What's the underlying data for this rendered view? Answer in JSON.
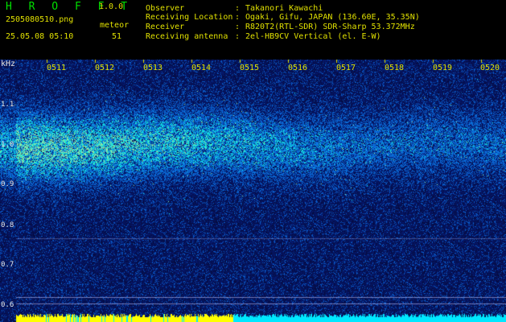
{
  "app": {
    "title": "H R O F F T",
    "version": "1.0.0"
  },
  "file": {
    "name": "2505080510.png",
    "datetime": "25.05.08 05:10"
  },
  "meteor": {
    "label": "meteor",
    "count": "51"
  },
  "info": [
    {
      "key": "Observer",
      "value": "Takanori Kawachi"
    },
    {
      "key": "Receiving Location",
      "value": "Ogaki, Gifu, JAPAN (136.60E, 35.35N)"
    },
    {
      "key": "Receiver",
      "value": "R820T2(RTL-SDR) SDR-Sharp 53.372MHz"
    },
    {
      "key": "Receiving antenna",
      "value": "2el-HB9CV Vertical (el. E-W)"
    }
  ],
  "separator": ":",
  "axis": {
    "unit": "kHz",
    "y_ticks": [
      "1.1",
      "1.0",
      "0.9",
      "0.8",
      "0.7",
      "0.6"
    ],
    "x_ticks": [
      "0511",
      "0512",
      "0513",
      "0514",
      "0515",
      "0516",
      "0517",
      "0518",
      "0519",
      "0520"
    ]
  },
  "colors": {
    "background": "#05093a",
    "label": "#e0e000",
    "title": "#00e000",
    "signal": "#40ffa0",
    "activity_bar": "#ffff00",
    "activity_bar_alt": "#00e8ff"
  }
}
